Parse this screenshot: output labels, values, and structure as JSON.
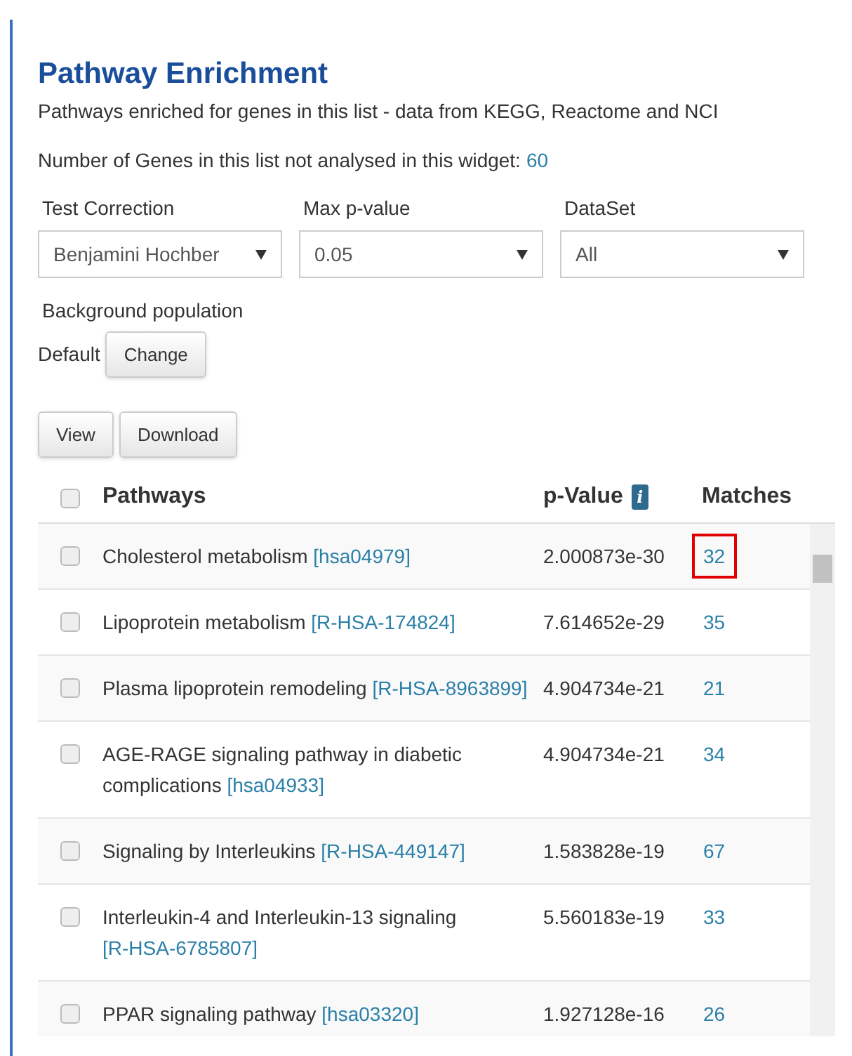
{
  "title": "Pathway Enrichment",
  "description": "Pathways enriched for genes in this list - data from KEGG, Reactome and NCI",
  "not_analysed": {
    "label": "Number of Genes in this list not analysed in this widget:",
    "count": "60"
  },
  "filters": [
    {
      "label": "Test Correction",
      "value": "Benjamini Hochber"
    },
    {
      "label": "Max p-value",
      "value": "0.05"
    },
    {
      "label": "DataSet",
      "value": "All"
    }
  ],
  "background": {
    "label": "Background population",
    "value": "Default",
    "button": "Change"
  },
  "buttons": [
    "View",
    "Download"
  ],
  "table": {
    "columns": [
      "Pathways",
      "p-Value",
      "Matches"
    ],
    "info_icon": "i",
    "select_all_checked": false,
    "rows": [
      {
        "name": "Cholesterol metabolism",
        "id": "[hsa04979]",
        "p_value": "2.000873e-30",
        "matches": "32",
        "checked": false,
        "highlighted": true
      },
      {
        "name": "Lipoprotein metabolism",
        "id": "[R-HSA-174824]",
        "p_value": "7.614652e-29",
        "matches": "35",
        "checked": false,
        "highlighted": false
      },
      {
        "name": "Plasma lipoprotein remodeling",
        "id": "[R-HSA-8963899]",
        "p_value": "4.904734e-21",
        "matches": "21",
        "checked": false,
        "highlighted": false
      },
      {
        "name": "AGE-RAGE signaling pathway in diabetic complications",
        "id": "[hsa04933]",
        "p_value": "4.904734e-21",
        "matches": "34",
        "checked": false,
        "highlighted": false
      },
      {
        "name": "Signaling by Interleukins",
        "id": "[R-HSA-449147]",
        "p_value": "1.583828e-19",
        "matches": "67",
        "checked": false,
        "highlighted": false
      },
      {
        "name": "Interleukin-4 and Interleukin-13 signaling",
        "id": "[R-HSA-6785807]",
        "p_value": "5.560183e-19",
        "matches": "33",
        "checked": false,
        "highlighted": false
      },
      {
        "name": "PPAR signaling pathway",
        "id": "[hsa03320]",
        "p_value": "1.927128e-16",
        "matches": "26",
        "checked": false,
        "highlighted": false
      }
    ]
  }
}
